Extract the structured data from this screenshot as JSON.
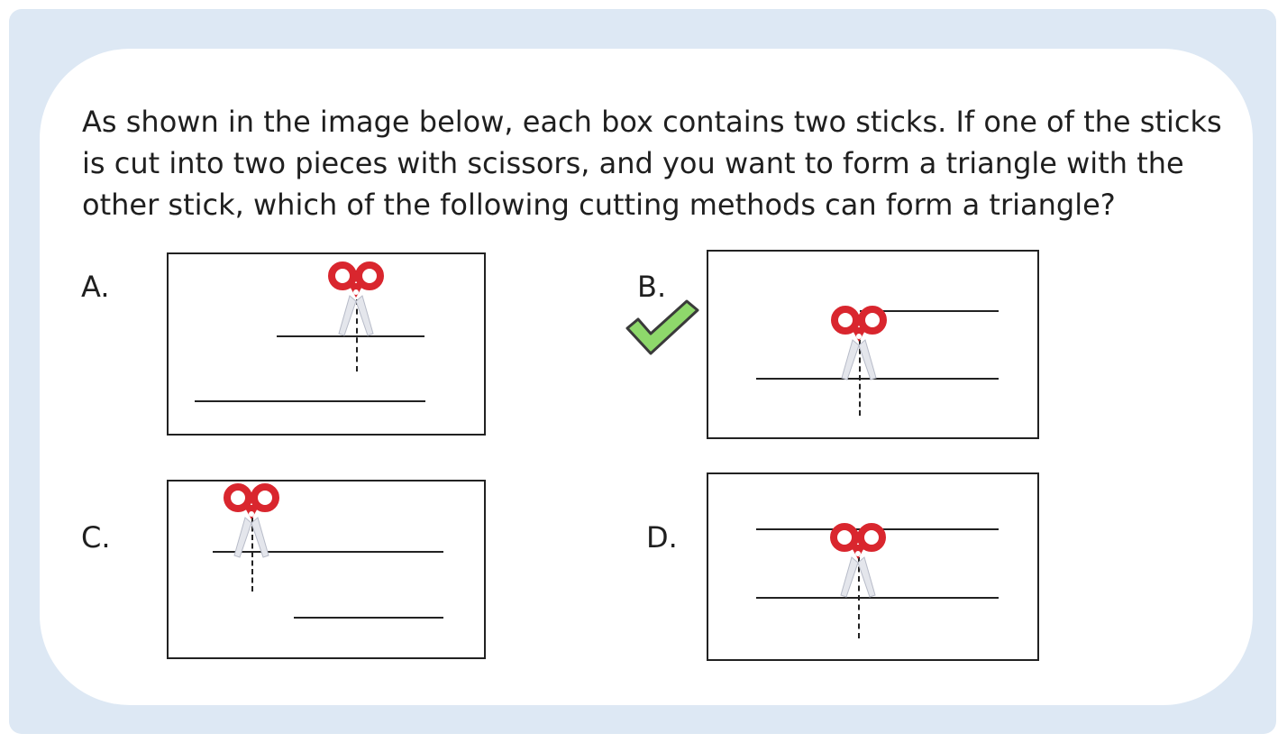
{
  "question": {
    "text": "As shown in the image below, each box contains two sticks. If one of the sticks is cut into two pieces with scissors, and you want to form a triangle with the other stick, which of the following cutting methods can form a triangle?"
  },
  "options": [
    {
      "label": "A."
    },
    {
      "label": "B."
    },
    {
      "label": "C."
    },
    {
      "label": "D."
    }
  ],
  "correct_answer": "B.",
  "icons": {
    "scissors": "scissors-icon",
    "check": "checkmark-icon"
  },
  "colors": {
    "frame": "#dde8f4",
    "scissors_handle": "#d9262e",
    "check_fill": "#8ed86b",
    "check_stroke": "#3a3a3a"
  }
}
